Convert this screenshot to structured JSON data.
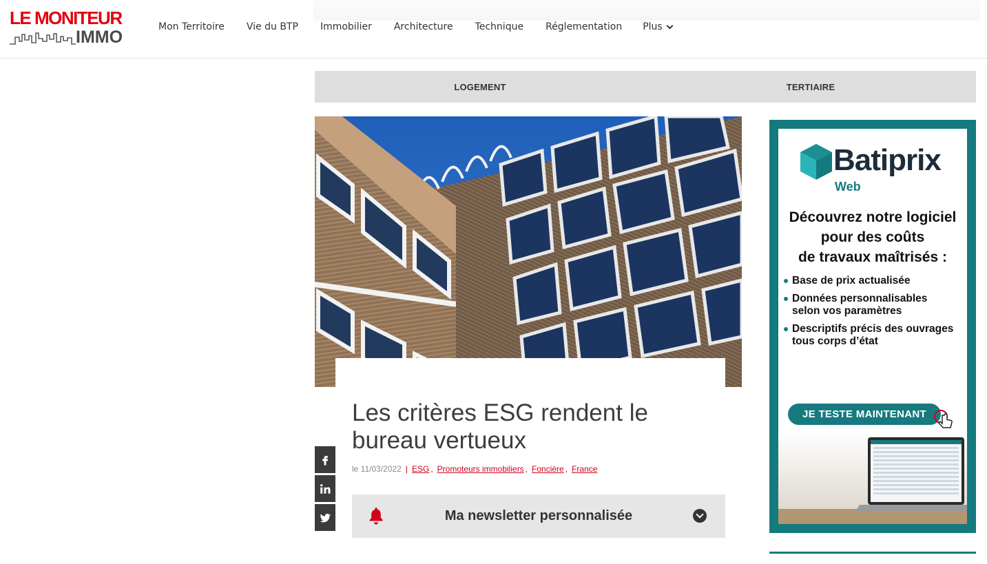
{
  "header": {
    "logo": {
      "line1": "LE MONITEUR",
      "line2": "IMMO"
    },
    "nav": [
      "Mon Territoire",
      "Vie du BTP",
      "Immobilier",
      "Architecture",
      "Technique",
      "Réglementation"
    ],
    "more_label": "Plus"
  },
  "categories": [
    "LOGEMENT",
    "TERTIAIRE"
  ],
  "article": {
    "title": "Les critères ESG rendent le bureau vertueux",
    "date": "le 11/03/2022",
    "tags": [
      "ESG",
      "Promoteurs immobiliers",
      "Foncière",
      "France"
    ]
  },
  "social": [
    {
      "name": "facebook-icon",
      "glyph": "f"
    },
    {
      "name": "linkedin-icon",
      "glyph": "in"
    },
    {
      "name": "twitter-icon",
      "glyph": "twitter"
    }
  ],
  "newsletter": {
    "label": "Ma newsletter personnalisée"
  },
  "ad": {
    "brand": "Batiprix",
    "brand_sub": "Web",
    "headline": [
      "Découvrez notre logiciel",
      "pour des coûts",
      "de travaux maîtrisés :"
    ],
    "bullets": [
      [
        "Base de prix actualisée"
      ],
      [
        "Données personnalisables",
        "selon vos paramètres"
      ],
      [
        "Descriptifs précis des ouvrages",
        "tous corps d’état"
      ]
    ],
    "cta": "JE TESTE MAINTENANT"
  },
  "colors": {
    "accent_red": "#d0021b",
    "ad_teal": "#157a7e",
    "nav_text": "#333333"
  }
}
